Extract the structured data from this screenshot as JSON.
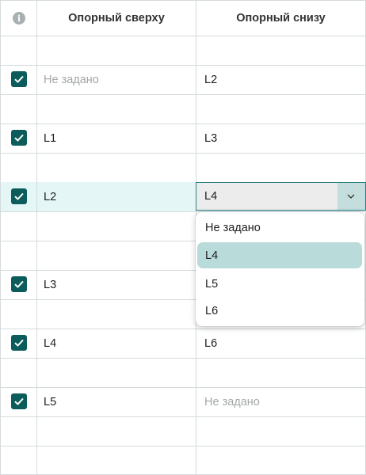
{
  "table": {
    "header": {
      "info_icon": "info-icon",
      "col_top": "Опорный сверху",
      "col_bottom": "Опорный снизу"
    },
    "rows": [
      {
        "checked": false,
        "top": "",
        "bottom": ""
      },
      {
        "checked": true,
        "top": "Не задано",
        "bottom": "L2"
      },
      {
        "checked": false,
        "top": "",
        "bottom": ""
      },
      {
        "checked": true,
        "top": "L1",
        "bottom": "L3"
      },
      {
        "checked": false,
        "top": "",
        "bottom": ""
      },
      {
        "checked": true,
        "top": "L2",
        "bottom": "L4"
      },
      {
        "checked": false,
        "top": "",
        "bottom": ""
      },
      {
        "checked": false,
        "top": "",
        "bottom": ""
      },
      {
        "checked": true,
        "top": "L3",
        "bottom": ""
      },
      {
        "checked": false,
        "top": "",
        "bottom": ""
      },
      {
        "checked": true,
        "top": "L4",
        "bottom": "L6"
      },
      {
        "checked": false,
        "top": "",
        "bottom": ""
      },
      {
        "checked": true,
        "top": "L5",
        "bottom": "Не задано"
      },
      {
        "checked": false,
        "top": "",
        "bottom": ""
      },
      {
        "checked": false,
        "top": "",
        "bottom": ""
      }
    ]
  },
  "editor": {
    "value": "L4",
    "options": [
      "Не задано",
      "L4",
      "L5",
      "L6"
    ],
    "selected": "L4"
  },
  "colors": {
    "checkbox": "#0c5c5c",
    "selected_row": "#e4f6f6",
    "active_option": "#b9dcda"
  }
}
